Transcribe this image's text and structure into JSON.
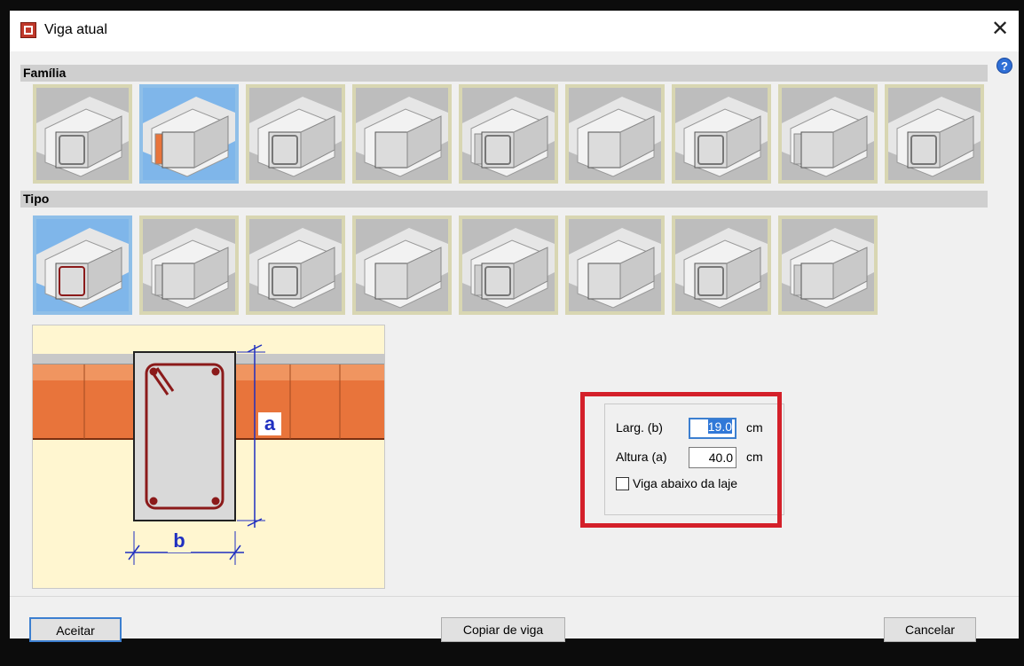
{
  "window": {
    "title": "Viga atual",
    "close_glyph": "✕",
    "help_glyph": "?"
  },
  "familia": {
    "header": "Família",
    "items": [
      {
        "icon": "beam-family-flat-slab-icon",
        "selected": false
      },
      {
        "icon": "beam-family-ceramic-slab-icon",
        "selected": true
      },
      {
        "icon": "beam-family-precast-joist-icon",
        "selected": false
      },
      {
        "icon": "beam-family-waffle-slab-icon",
        "selected": false
      },
      {
        "icon": "beam-family-embedded-beam-icon",
        "selected": false
      },
      {
        "icon": "beam-family-box-section-icon",
        "selected": false
      },
      {
        "icon": "beam-family-plain-slab-icon",
        "selected": false
      },
      {
        "icon": "beam-family-steel-i-beam-icon",
        "selected": false
      },
      {
        "icon": "beam-family-wall-beam-icon",
        "selected": false
      }
    ]
  },
  "tipo": {
    "header": "Tipo",
    "items": [
      {
        "icon": "beam-type-rectangular-icon",
        "selected": true
      },
      {
        "icon": "beam-type-flat-icon",
        "selected": false
      },
      {
        "icon": "beam-type-inverted-icon",
        "selected": false
      },
      {
        "icon": "beam-type-l-section-icon",
        "selected": false
      },
      {
        "icon": "beam-type-t-section-icon",
        "selected": false
      },
      {
        "icon": "beam-type-inverted-t-icon",
        "selected": false
      },
      {
        "icon": "beam-type-double-l-icon",
        "selected": false
      },
      {
        "icon": "beam-type-rectangular-open-icon",
        "selected": false
      }
    ]
  },
  "preview": {
    "label_a": "a",
    "label_b": "b"
  },
  "fields": {
    "width_label": "Larg. (b)",
    "width_value": "19.0",
    "height_label": "Altura (a)",
    "height_value": "40.0",
    "unit": "cm",
    "checkbox_label": "Viga abaixo da laje",
    "checkbox_checked": false
  },
  "buttons": {
    "accept": "Aceitar",
    "copy": "Copiar de viga",
    "cancel": "Cancelar"
  },
  "colors": {
    "highlight": "#d4202a",
    "selected_border": "#8fbfe8",
    "brick": "#e8743b",
    "rebar": "#8b1a1a"
  }
}
